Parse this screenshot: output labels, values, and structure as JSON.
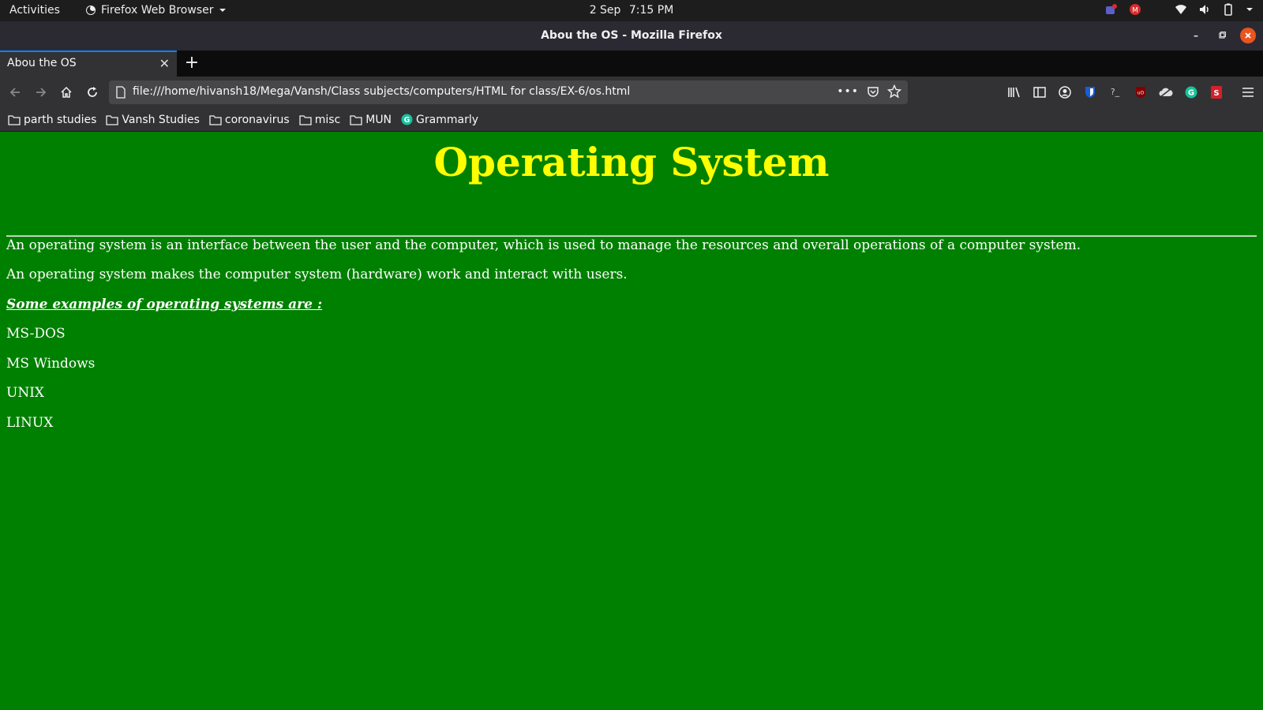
{
  "system": {
    "activities": "Activities",
    "app_name": "Firefox Web Browser",
    "date": "2 Sep",
    "time": "7:15 PM"
  },
  "window": {
    "title": "Abou the OS - Mozilla Firefox"
  },
  "tabs": [
    {
      "label": "Abou the OS",
      "active": true
    }
  ],
  "navigation": {
    "url": "file:///home/hivansh18/Mega/Vansh/Class subjects/computers/HTML for class/EX-6/os.html"
  },
  "bookmarks": [
    {
      "label": "parth studies",
      "icon": "folder-icon"
    },
    {
      "label": "Vansh Studies",
      "icon": "folder-icon"
    },
    {
      "label": "coronavirus",
      "icon": "folder-icon"
    },
    {
      "label": "misc",
      "icon": "folder-icon"
    },
    {
      "label": "MUN",
      "icon": "folder-icon"
    },
    {
      "label": "Grammarly",
      "icon": "grammarly-icon"
    }
  ],
  "page": {
    "heading": "Operating System",
    "paragraphs": [
      "An operating system is an interface between the user and the computer, which is used to manage the resources and overall operations of a computer system.",
      "An operating system makes the computer system (hardware) work and interact with users."
    ],
    "examples_heading": "Some examples of operating systems are :",
    "examples": [
      "MS-DOS",
      "MS Windows",
      "UNIX",
      "LINUX"
    ]
  },
  "colors": {
    "page_background": "#008000",
    "heading": "#ffff00",
    "body_text": "#ffffff",
    "tab_accent": "#0a84ff",
    "close_button": "#e95420"
  }
}
